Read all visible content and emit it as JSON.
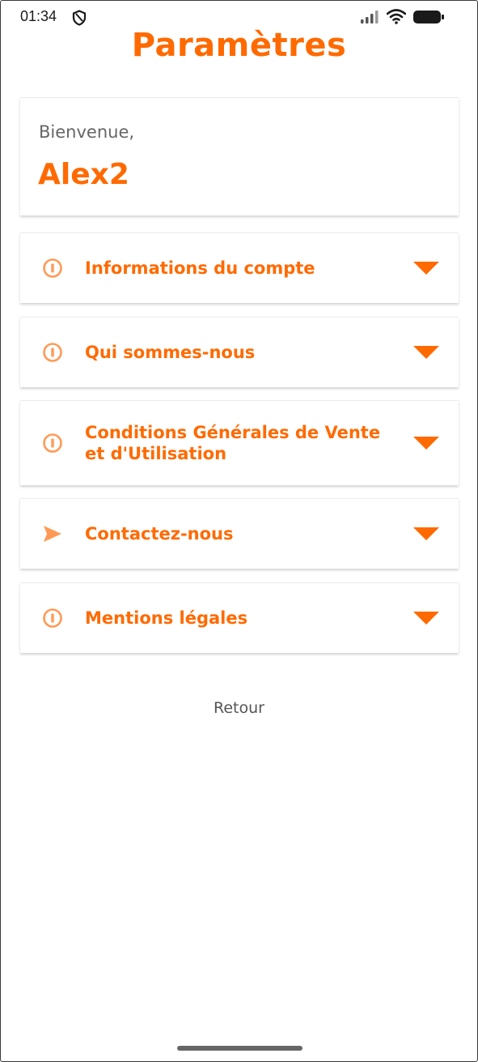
{
  "status_bar": {
    "time": "01:34",
    "icons": [
      "shield-icon",
      "signal-icon",
      "wifi-icon",
      "battery-icon"
    ]
  },
  "page_title": "Paramètres",
  "welcome": {
    "greeting": "Bienvenue,",
    "username": "Alex2"
  },
  "menu": [
    {
      "label": "Informations du compte",
      "icon": "info-icon"
    },
    {
      "label": "Qui sommes-nous",
      "icon": "info-icon"
    },
    {
      "label": "Conditions Générales de Vente et d'Utilisation",
      "icon": "info-icon"
    },
    {
      "label": "Contactez-nous",
      "icon": "send-icon"
    },
    {
      "label": "Mentions légales",
      "icon": "info-icon"
    }
  ],
  "back_label": "Retour",
  "colors": {
    "accent": "#ff6a00",
    "accent_light": "#ff9a55",
    "text_muted": "#666666"
  }
}
